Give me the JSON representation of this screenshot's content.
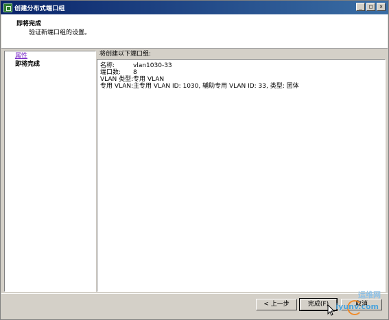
{
  "window": {
    "title": "创建分布式端口组",
    "buttons": [
      "_",
      "□",
      "×"
    ]
  },
  "header": {
    "title": "即将完成",
    "subtitle": "验证新端口组的设置。"
  },
  "nav": {
    "items": [
      {
        "label": "属性",
        "state": "link"
      },
      {
        "label": "即将完成",
        "state": "current"
      }
    ]
  },
  "main": {
    "section_label": "将创建以下端口组:",
    "fields": [
      {
        "key": "名称:",
        "value": "vlan1030-33"
      },
      {
        "key": "端口数:",
        "value": "8"
      },
      {
        "key": "VLAN 类型:",
        "value": "专用 VLAN"
      },
      {
        "key": "专用 VLAN:",
        "value": "主专用 VLAN ID: 1030, 辅助专用 VLAN ID: 33, 类型: 团体"
      }
    ]
  },
  "footer": {
    "back_label": "< 上一步",
    "finish_label": "完成(F)",
    "cancel_label": "取消"
  },
  "watermark": {
    "line1": "运维网",
    "line2": "iyunv.com"
  }
}
